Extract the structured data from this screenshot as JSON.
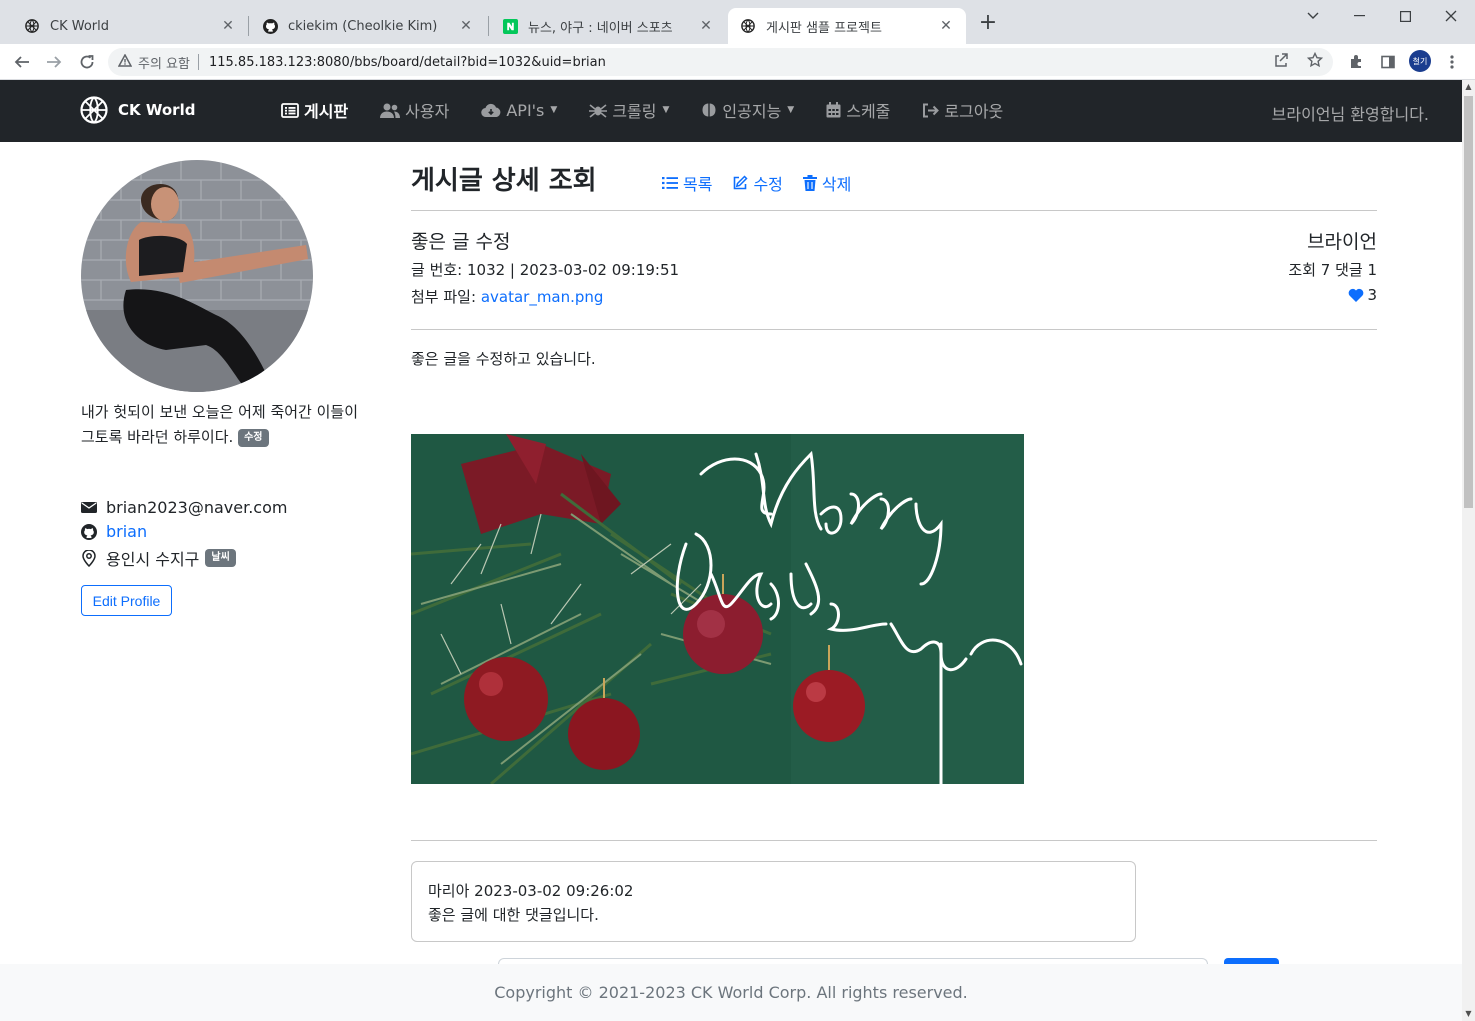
{
  "browser": {
    "tabs": [
      {
        "title": "CK World",
        "active": false
      },
      {
        "title": "ckiekim (Cheolkie Kim)",
        "active": false
      },
      {
        "title": "뉴스, 야구 : 네이버 스포츠",
        "active": false
      },
      {
        "title": "게시판 샘플 프로젝트",
        "active": true
      }
    ],
    "security_label": "주의 요함",
    "url": "115.85.183.123:8080/bbs/board/detail?bid=1032&uid=brian",
    "profile_initials": "철기"
  },
  "navbar": {
    "brand": "CK World",
    "items": [
      {
        "label": "게시판",
        "icon": "list-alt-icon",
        "active": true,
        "dropdown": false
      },
      {
        "label": "사용자",
        "icon": "users-icon",
        "active": false,
        "dropdown": false
      },
      {
        "label": "API's",
        "icon": "cloud-icon",
        "active": false,
        "dropdown": true
      },
      {
        "label": "크롤링",
        "icon": "spider-icon",
        "active": false,
        "dropdown": true
      },
      {
        "label": "인공지능",
        "icon": "brain-icon",
        "active": false,
        "dropdown": true
      },
      {
        "label": "스케줄",
        "icon": "calendar-icon",
        "active": false,
        "dropdown": false
      },
      {
        "label": "로그아웃",
        "icon": "logout-icon",
        "active": false,
        "dropdown": false
      }
    ],
    "welcome": "브라이언님 환영합니다."
  },
  "sidebar": {
    "bio_line1": "내가 헛되이 보낸 오늘은 어제 죽어간 이들이",
    "bio_line2": "그토록 바라던 하루이다.",
    "bio_badge": "수정",
    "email": "brian2023@naver.com",
    "github": "brian",
    "location": "용인시 수지구",
    "weather_badge": "날씨",
    "edit_button": "Edit Profile"
  },
  "main": {
    "title": "게시글 상세 조회",
    "actions": {
      "list": "목록",
      "edit": "수정",
      "delete": "삭제"
    },
    "post": {
      "title": "좋은 글 수정",
      "meta": "글 번호: 1032 | 2023-03-02 09:19:51",
      "file_label": "첨부 파일:",
      "file_name": "avatar_man.png",
      "author": "브라이언",
      "stats": "조회 7  댓글 1",
      "likes": "3",
      "body": "좋은 글을 수정하고 있습니다."
    },
    "comments": [
      {
        "header": "마리아  2023-03-02 09:26:02",
        "text": "좋은 글에 대한 댓글입니다."
      }
    ]
  },
  "footer": {
    "text": "Copyright © 2021-2023 CK World Corp. All rights reserved."
  },
  "colors": {
    "primary": "#0d6efd",
    "navbar_bg": "#212529",
    "badge": "#6c757d"
  }
}
